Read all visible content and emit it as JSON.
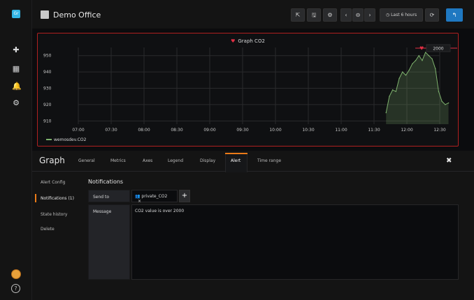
{
  "sidemenu": {
    "logo_text": "Gr"
  },
  "navbar": {
    "title": "Demo Office",
    "time_range_label": "Last 6 hours",
    "share_glyph": "⇱",
    "save_glyph": "🖫",
    "settings_glyph": "⚙",
    "prev_glyph": "‹",
    "zoom_glyph": "⊖",
    "next_glyph": "›",
    "refresh_glyph": "⟳",
    "back_glyph": "↰"
  },
  "panel": {
    "title": "Graph CO2",
    "threshold_label": "2000",
    "legend_series": "wemosdev.CO2"
  },
  "chart_data": {
    "type": "line",
    "title": "Graph CO2",
    "x": [
      "07:00",
      "07:30",
      "08:00",
      "08:30",
      "09:00",
      "09:30",
      "10:00",
      "10:30",
      "11:00",
      "11:30",
      "12:00",
      "12:30"
    ],
    "yticks": [
      910,
      920,
      930,
      940,
      950
    ],
    "ylim": [
      908,
      955
    ],
    "series": [
      {
        "name": "wemosdev.CO2",
        "color": "#7eb26d",
        "points": [
          [
            "11:41",
            915
          ],
          [
            "11:44",
            925
          ],
          [
            "11:47",
            929
          ],
          [
            "11:50",
            928
          ],
          [
            "11:53",
            936
          ],
          [
            "11:56",
            940
          ],
          [
            "11:59",
            938
          ],
          [
            "12:02",
            941
          ],
          [
            "12:05",
            945
          ],
          [
            "12:08",
            947
          ],
          [
            "12:11",
            950
          ],
          [
            "12:14",
            947
          ],
          [
            "12:17",
            952
          ],
          [
            "12:20",
            950
          ],
          [
            "12:23",
            948
          ],
          [
            "12:26",
            942
          ],
          [
            "12:29",
            928
          ],
          [
            "12:32",
            922
          ],
          [
            "12:35",
            920
          ],
          [
            "12:38",
            921
          ]
        ]
      }
    ],
    "threshold": {
      "label": "2000",
      "color": "#e02f44"
    },
    "grid": true,
    "legend": "bottom-left"
  },
  "editor": {
    "title": "Graph",
    "tabs": [
      "General",
      "Metrics",
      "Axes",
      "Legend",
      "Display",
      "Alert",
      "Time range"
    ],
    "active_tab": "Alert",
    "close_glyph": "✖",
    "sidenav": [
      "Alert Config",
      "Notifications (1)",
      "State history",
      "Delete"
    ],
    "notifications_title": "Notifications",
    "send_to_label": "Send to",
    "send_to_value": "private_CO2",
    "remove_glyph": "×",
    "add_glyph": "+",
    "message_label": "Message",
    "message_value": "CO2 value is over 2000"
  }
}
